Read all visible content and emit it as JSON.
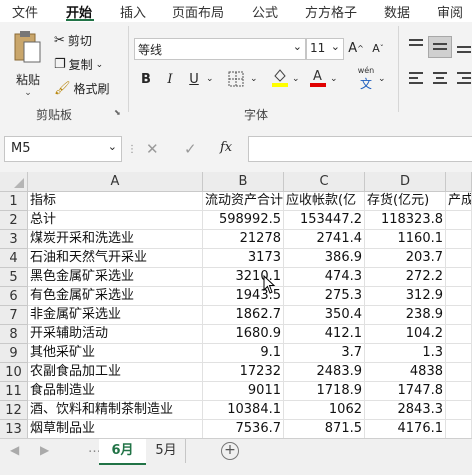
{
  "ribbon_tabs": [
    "文件",
    "开始",
    "插入",
    "页面布局",
    "公式",
    "方方格子",
    "数据",
    "审阅"
  ],
  "active_tab": "开始",
  "clipboard": {
    "paste": "粘贴",
    "cut": "剪切",
    "copy": "复制",
    "format_painter": "格式刷",
    "group": "剪贴板"
  },
  "font": {
    "name": "等线",
    "size": "11",
    "bold": "B",
    "italic": "I",
    "underline": "U",
    "phonetic": "wén",
    "group": "字体",
    "grow": "A",
    "shrink": "A"
  },
  "formula_bar": {
    "name_box": "M5",
    "fx": "fx",
    "value": ""
  },
  "columns": [
    "A",
    "B",
    "C",
    "D"
  ],
  "rows": [
    {
      "n": "1",
      "a": "指标",
      "b": "流动资产合计",
      "c": "应收帐款(亿",
      "d": "存货(亿元)",
      "e": "产成"
    },
    {
      "n": "2",
      "a": "总计",
      "b": "598992.5",
      "c": "153447.2",
      "d": "118323.8",
      "e": ""
    },
    {
      "n": "3",
      "a": "煤炭开采和洗选业",
      "b": "21278",
      "c": "2741.4",
      "d": "1160.1",
      "e": ""
    },
    {
      "n": "4",
      "a": "石油和天然气开采业",
      "b": "3173",
      "c": "386.9",
      "d": "203.7",
      "e": ""
    },
    {
      "n": "5",
      "a": "黑色金属矿采选业",
      "b": "3210.1",
      "c": "474.3",
      "d": "272.2",
      "e": ""
    },
    {
      "n": "6",
      "a": "有色金属矿采选业",
      "b": "1943.5",
      "c": "275.3",
      "d": "312.9",
      "e": ""
    },
    {
      "n": "7",
      "a": "非金属矿采选业",
      "b": "1862.7",
      "c": "350.4",
      "d": "238.9",
      "e": ""
    },
    {
      "n": "8",
      "a": "开采辅助活动",
      "b": "1680.9",
      "c": "412.1",
      "d": "104.2",
      "e": ""
    },
    {
      "n": "9",
      "a": "其他采矿业",
      "b": "9.1",
      "c": "3.7",
      "d": "1.3",
      "e": ""
    },
    {
      "n": "10",
      "a": "农副食品加工业",
      "b": "17232",
      "c": "2483.9",
      "d": "4838",
      "e": ""
    },
    {
      "n": "11",
      "a": "食品制造业",
      "b": "9011",
      "c": "1718.9",
      "d": "1747.8",
      "e": ""
    },
    {
      "n": "12",
      "a": "酒、饮料和精制茶制造业",
      "b": "10384.1",
      "c": "1062",
      "d": "2843.3",
      "e": ""
    },
    {
      "n": "13",
      "a": "烟草制品业",
      "b": "7536.7",
      "c": "871.5",
      "d": "4176.1",
      "e": ""
    }
  ],
  "sheets": [
    "6月",
    "5月"
  ],
  "active_sheet": "6月",
  "colors": {
    "accent": "#217346",
    "highlight": "#ffff00",
    "font_red": "#e00000"
  }
}
